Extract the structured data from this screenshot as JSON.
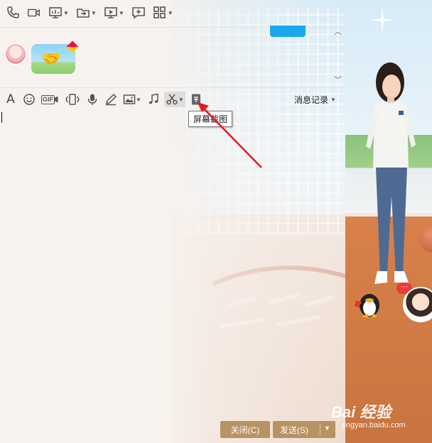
{
  "top_toolbar": {
    "items": [
      {
        "name": "phone-icon",
        "has_dropdown": false
      },
      {
        "name": "video-call-icon",
        "has_dropdown": false
      },
      {
        "name": "screen-share-icon",
        "has_dropdown": true
      },
      {
        "name": "file-transfer-icon",
        "has_dropdown": true
      },
      {
        "name": "remote-desktop-icon",
        "has_dropdown": true
      },
      {
        "name": "new-chat-icon",
        "has_dropdown": false
      },
      {
        "name": "apps-grid-icon",
        "has_dropdown": true
      }
    ]
  },
  "input_toolbar": {
    "font_label": "A",
    "gif_label": "GIF",
    "tools": [
      "font-icon",
      "emoji-icon",
      "gif-icon",
      "shake-icon",
      "voice-icon",
      "handwriting-icon",
      "image-icon",
      "music-icon",
      "screenshot-icon",
      "template-icon"
    ],
    "history_label": "消息记录"
  },
  "tooltip": {
    "text": "屏幕截图"
  },
  "buttons": {
    "close_label": "关闭(C)",
    "send_label": "发送(S)"
  },
  "watermark": {
    "main": "Bai 经验",
    "sub": "jingyan.baidu.com"
  },
  "chat_bubble_text": "···",
  "colors": {
    "accent_button": "#b89262",
    "arrow_red": "#e8171a",
    "notify_blue": "#18a8f0"
  }
}
